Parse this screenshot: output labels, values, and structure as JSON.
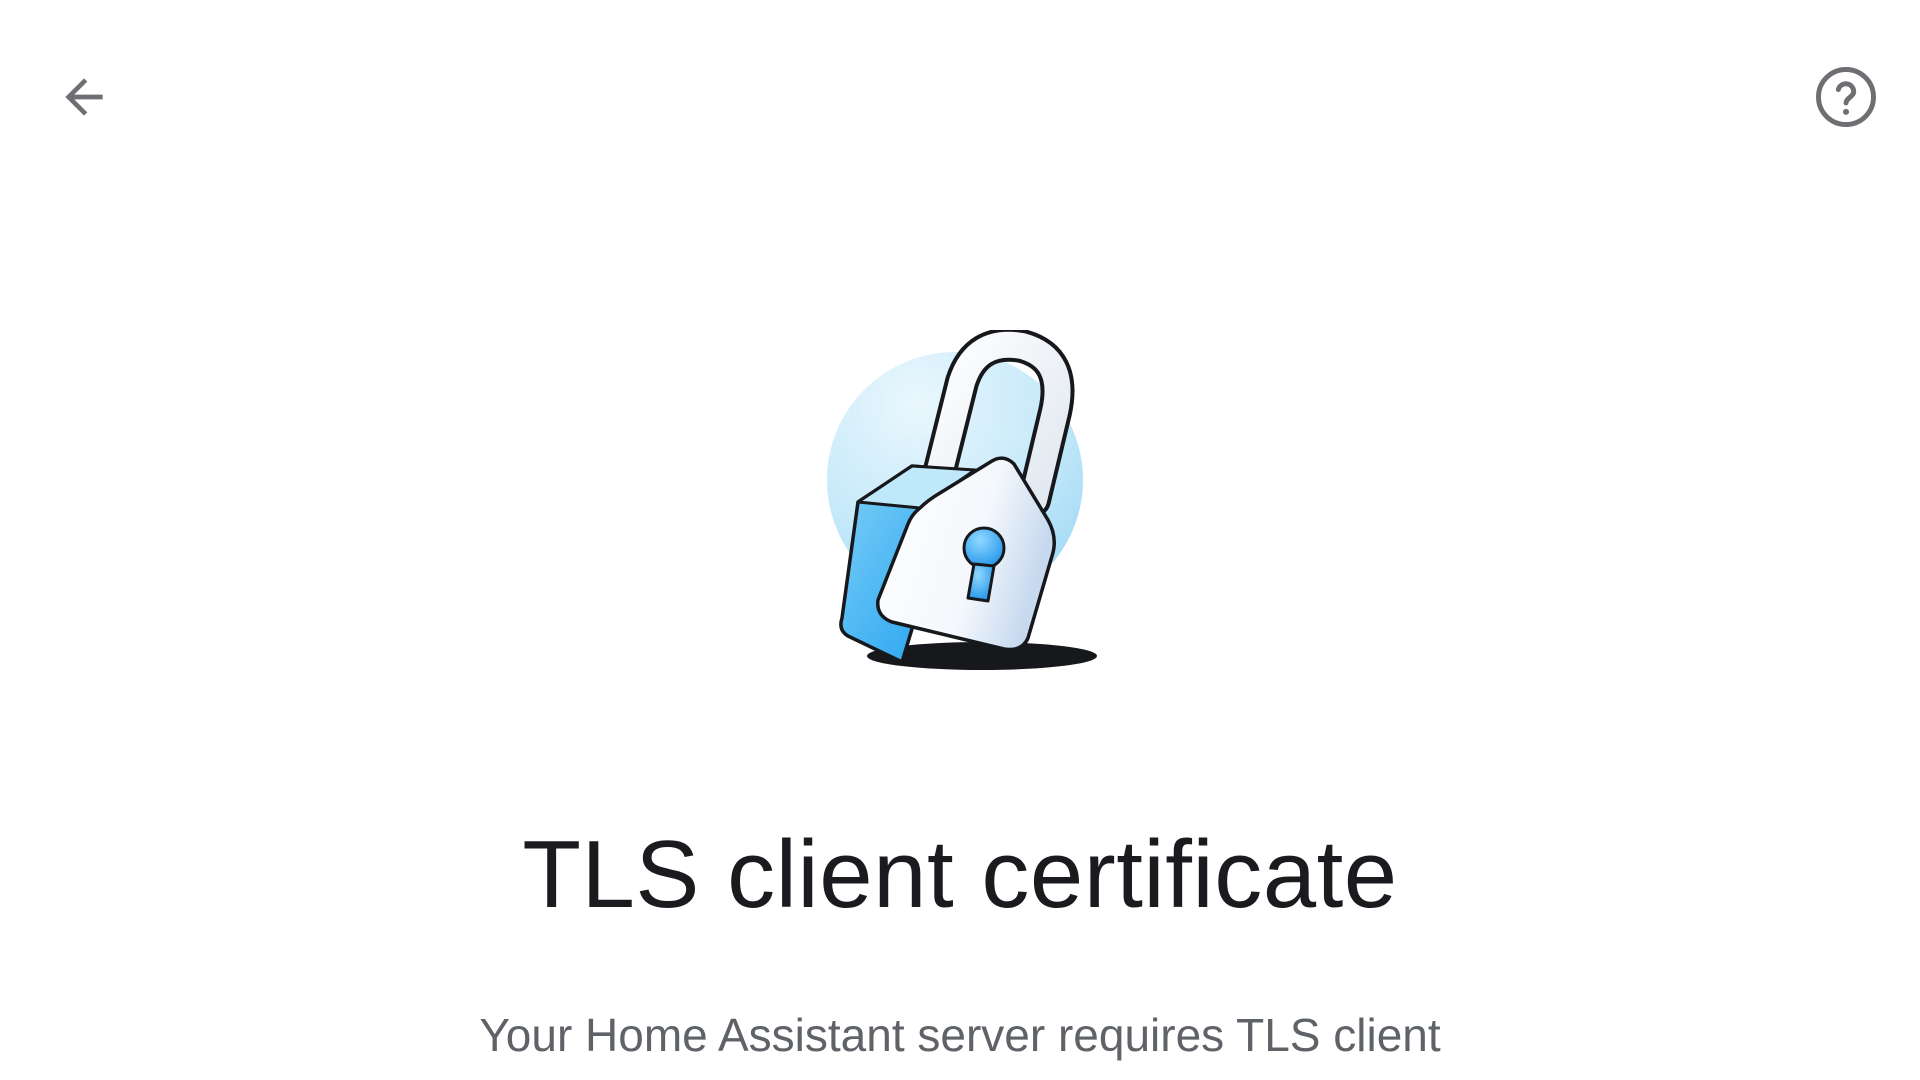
{
  "toolbar": {
    "back_icon": "arrow-back-icon",
    "help_icon": "help-circle-icon"
  },
  "illustration": {
    "icon": "padlock-icon",
    "colors": {
      "accent_blue": "#29a9f1",
      "light_blue": "#c9ecfb",
      "outline": "#1b1b1f"
    }
  },
  "content": {
    "title": "TLS client certificate",
    "description": "Your Home Assistant server requires TLS client"
  },
  "colors": {
    "title_text": "#1b1b1f",
    "body_text": "#5f6368",
    "icon_gray": "#6f6f73",
    "background": "#ffffff"
  }
}
